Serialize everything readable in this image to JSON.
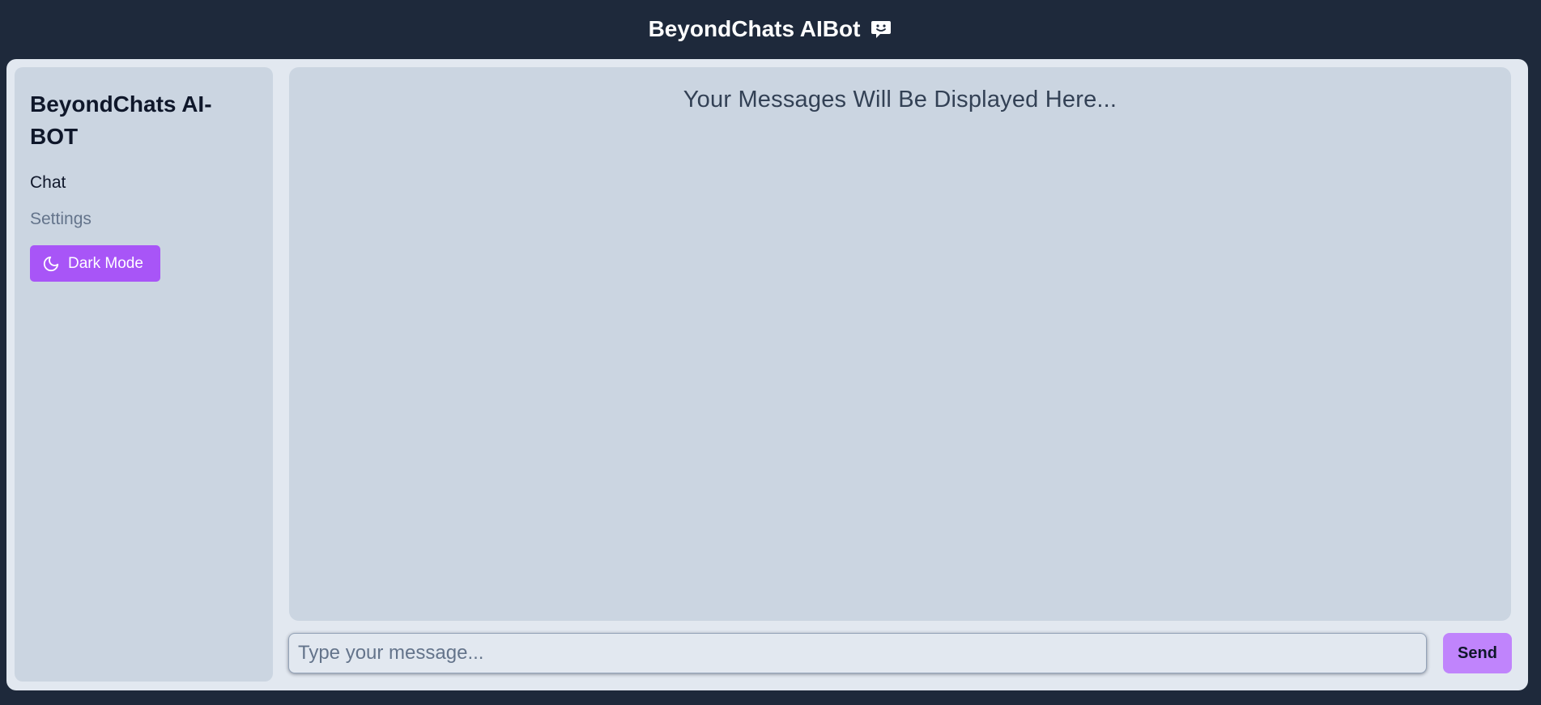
{
  "header": {
    "title": "BeyondChats AIBot",
    "icon": "chat-bot-icon"
  },
  "sidebar": {
    "brand": "BeyondChats AI-BOT",
    "nav": [
      {
        "label": "Chat",
        "active": true
      },
      {
        "label": "Settings",
        "active": false
      }
    ],
    "dark_mode_label": "Dark Mode",
    "dark_mode_icon": "moon-icon"
  },
  "messages": {
    "placeholder": "Your Messages Will Be Displayed Here..."
  },
  "composer": {
    "placeholder": "Type your message...",
    "value": "",
    "send_label": "Send"
  },
  "colors": {
    "header_bg": "#1e293b",
    "frame_bg": "#e2e8f0",
    "panel_bg": "#cbd5e1",
    "accent": "#a855f7",
    "send_bg": "#c084fc"
  }
}
